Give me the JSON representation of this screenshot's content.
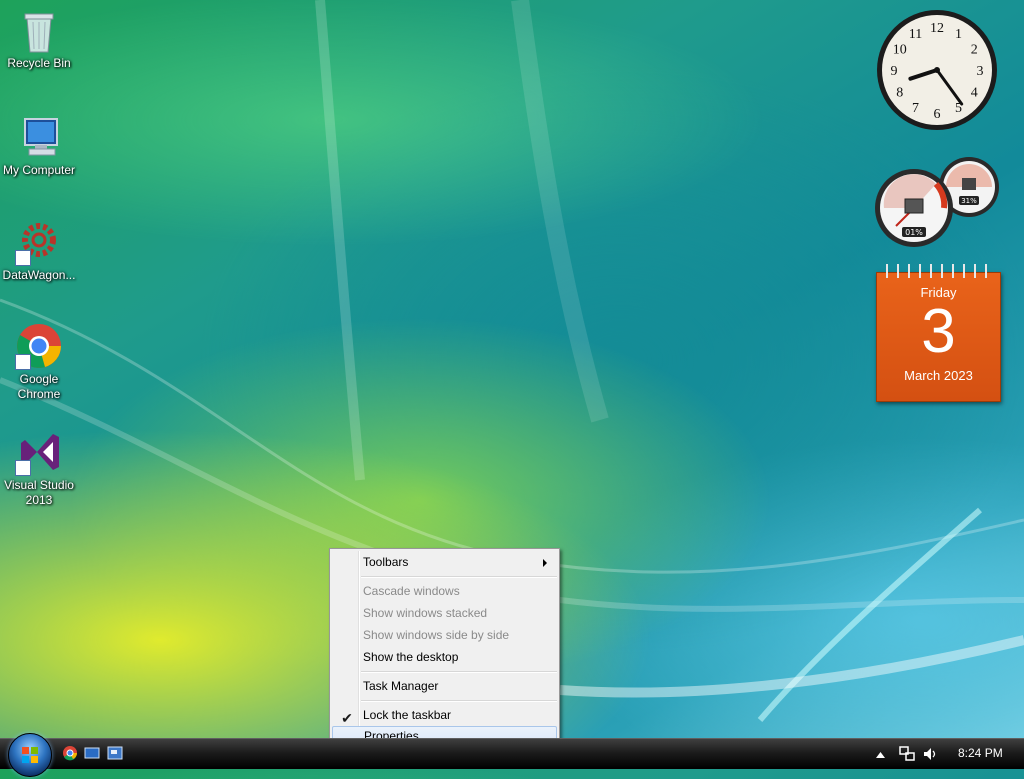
{
  "desktop": {
    "icons": [
      {
        "label": "Recycle Bin"
      },
      {
        "label": "My Computer"
      },
      {
        "label": "DataWagon..."
      },
      {
        "label": "Google Chrome"
      },
      {
        "label": "Visual Studio 2013"
      }
    ]
  },
  "gadgets": {
    "clock": {
      "numerals": [
        "12",
        "1",
        "2",
        "3",
        "4",
        "5",
        "6",
        "7",
        "8",
        "9",
        "10",
        "11"
      ],
      "time": "8:24"
    },
    "cpu_meter": {
      "cpu": "01%",
      "memory": "31%"
    },
    "calendar": {
      "weekday": "Friday",
      "day": "3",
      "month_year": "March 2023"
    }
  },
  "context_menu": {
    "toolbars": "Toolbars",
    "cascade": "Cascade windows",
    "stacked": "Show windows stacked",
    "side_by_side": "Show windows side by side",
    "show_desktop": "Show the desktop",
    "task_manager": "Task Manager",
    "lock_taskbar": "Lock the taskbar",
    "lock_checked": "✔",
    "properties": "Properties"
  },
  "taskbar": {
    "clock": "8:24 PM"
  },
  "colors": {
    "calendar": "#e2591a",
    "menu_highlight": "#dbe8f8"
  }
}
